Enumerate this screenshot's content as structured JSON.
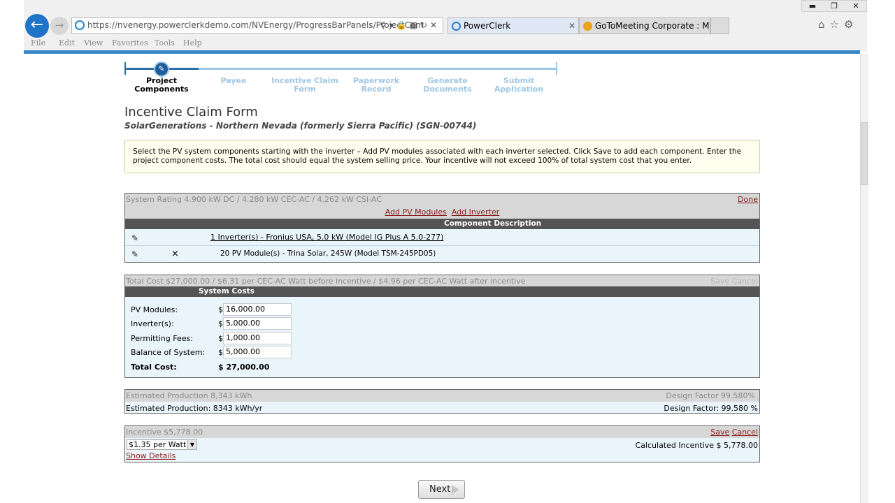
{
  "browser": {
    "url": "https://nvenergy.powerclerkdemo.com/NVEnergy/ProgressBarPanels/ProjectCom",
    "tabs": [
      {
        "label": "PowerClerk",
        "active": true
      },
      {
        "label": "GoToMeeting Corporate : My ...",
        "active": false
      }
    ],
    "menu": [
      "File",
      "Edit",
      "View",
      "Favorites",
      "Tools",
      "Help"
    ],
    "window_controls": {
      "minimize": "▬",
      "restore": "❐",
      "close": "✕"
    },
    "accent": "#3a87c9"
  },
  "progress": {
    "steps": [
      {
        "label_1": "Project",
        "label_2": "Components",
        "active": true
      },
      {
        "label_1": "Payee",
        "label_2": "",
        "active": false
      },
      {
        "label_1": "Incentive Claim",
        "label_2": "Form",
        "active": false
      },
      {
        "label_1": "Paperwork",
        "label_2": "Record",
        "active": false
      },
      {
        "label_1": "Generate",
        "label_2": "Documents",
        "active": false
      },
      {
        "label_1": "Submit",
        "label_2": "Application",
        "active": false
      }
    ]
  },
  "form": {
    "title": "Incentive Claim Form",
    "subtitle": "SolarGenerations - Northern Nevada (formerly Sierra Pacific) (SGN-00744)",
    "instructions": "Select the PV system components starting with the inverter – Add PV modules associated with each inverter selected. Click Save to add each component. Enter the project component costs. The total cost should equal the system selling price. Your incentive will not exceed 100% of total system cost that you enter."
  },
  "components": {
    "rating": "System Rating 4.900 kW DC / 4.280 kW CEC-AC / 4.262 kW CSI-AC",
    "done_label": "Done",
    "add_pv_label": "Add PV Modules",
    "add_inverter_label": "Add Inverter",
    "column_header": "Component Description",
    "rows": [
      {
        "description": "1 Inverter(s) - Fronius USA, 5.0 kW (Model IG Plus A 5.0-277)"
      },
      {
        "description": "20 PV Module(s) - Trina Solar, 245W (Model TSM-245PD05)",
        "delete": "×"
      }
    ]
  },
  "costs": {
    "summary": "Total Cost $27,000.00 / $6.31 per CEC-AC Watt before incentive / $4.96 per CEC-AC Watt after incentive",
    "save_label": "Save",
    "cancel_label": "Cancel",
    "header": "System Costs",
    "currency": "$",
    "rows": [
      {
        "label": "PV Modules:",
        "value": "16,000.00"
      },
      {
        "label": "Inverter(s):",
        "value": "5,000.00"
      },
      {
        "label": "Permitting Fees:",
        "value": "1,000.00"
      },
      {
        "label": "Balance of System:",
        "value": "5,000.00"
      }
    ],
    "total_label": "Total Cost:",
    "total_value": "$ 27,000.00"
  },
  "production": {
    "summary_left": "Estimated Production 8,343 kWh",
    "summary_right": "Design Factor 99.580%",
    "detail_left": "Estimated Production: 8343 kWh/yr",
    "detail_right": "Design Factor: 99.580 %"
  },
  "incentive": {
    "summary": "Incentive $5,778.00",
    "save_label": "Save",
    "cancel_label": "Cancel",
    "rate_selected": "$1.35 per Watt",
    "calculated": "Calculated Incentive $ 5,778.00",
    "show_details": "Show Details"
  },
  "next_label": "Next",
  "icons": {
    "back": "back-arrow-icon",
    "forward": "forward-arrow-icon",
    "edit": "pencil-icon",
    "home": "home-icon",
    "favorites": "star-icon",
    "settings": "gear-icon"
  }
}
